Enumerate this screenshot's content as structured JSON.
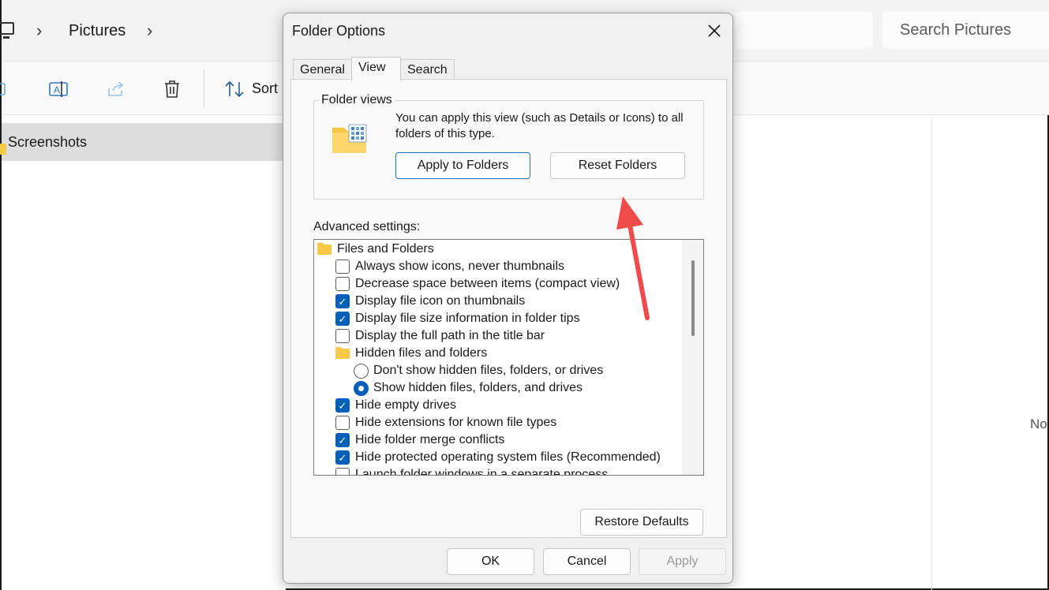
{
  "explorer": {
    "breadcrumb": "Pictures",
    "search_placeholder": "Search Pictures",
    "sort_label": "Sort",
    "nav_selected": "Screenshots",
    "partial_text": "No"
  },
  "dialog": {
    "title": "Folder Options",
    "tabs": [
      {
        "label": "General"
      },
      {
        "label": "View"
      },
      {
        "label": "Search"
      }
    ],
    "folder_views": {
      "legend": "Folder views",
      "description": "You can apply this view (such as Details or Icons) to all folders of this type.",
      "apply_button": "Apply to Folders",
      "reset_button": "Reset Folders"
    },
    "advanced_label": "Advanced settings:",
    "settings": [
      {
        "type": "folder",
        "label": "Files and Folders"
      },
      {
        "type": "checkbox",
        "checked": false,
        "label": "Always show icons, never thumbnails"
      },
      {
        "type": "checkbox",
        "checked": false,
        "label": "Decrease space between items (compact view)"
      },
      {
        "type": "checkbox",
        "checked": true,
        "label": "Display file icon on thumbnails"
      },
      {
        "type": "checkbox",
        "checked": true,
        "label": "Display file size information in folder tips"
      },
      {
        "type": "checkbox",
        "checked": false,
        "label": "Display the full path in the title bar"
      },
      {
        "type": "folder",
        "label": "Hidden files and folders"
      },
      {
        "type": "radio",
        "checked": false,
        "label": "Don't show hidden files, folders, or drives"
      },
      {
        "type": "radio",
        "checked": true,
        "label": "Show hidden files, folders, and drives"
      },
      {
        "type": "checkbox",
        "checked": true,
        "label": "Hide empty drives"
      },
      {
        "type": "checkbox",
        "checked": false,
        "label": "Hide extensions for known file types"
      },
      {
        "type": "checkbox",
        "checked": true,
        "label": "Hide folder merge conflicts"
      },
      {
        "type": "checkbox",
        "checked": true,
        "label": "Hide protected operating system files (Recommended)"
      },
      {
        "type": "checkbox",
        "checked": false,
        "label": "Launch folder windows in a separate process"
      }
    ],
    "restore_defaults": "Restore Defaults",
    "ok": "OK",
    "cancel": "Cancel",
    "apply": "Apply"
  },
  "colors": {
    "accent": "#005fb8",
    "annotation_arrow": "#f04a4a"
  }
}
